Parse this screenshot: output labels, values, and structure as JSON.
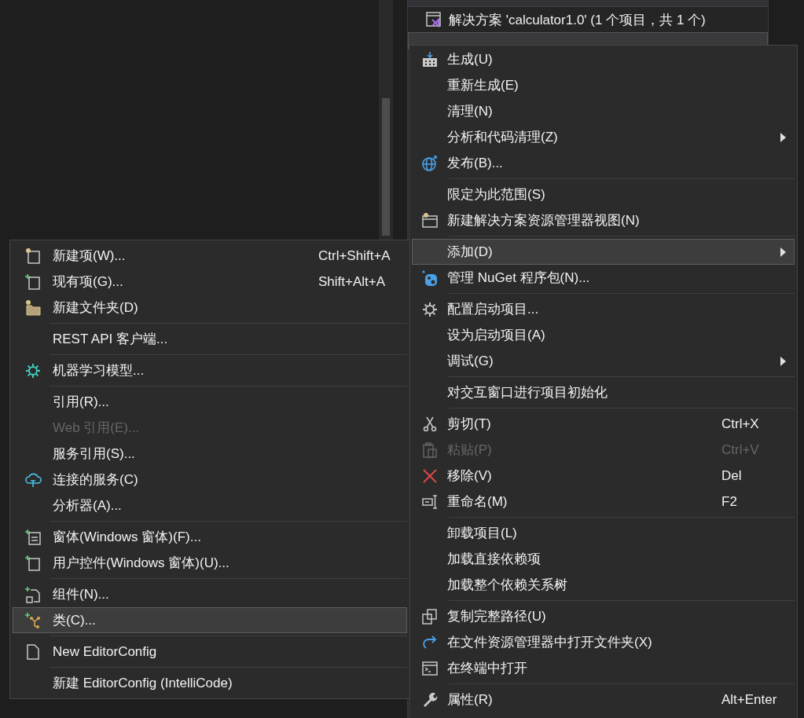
{
  "solution_explorer": {
    "solution_row": {
      "label": "解决方案 'calculator1.0' (1 个项目，共 1 个)"
    }
  },
  "project_menu": {
    "items": [
      {
        "kind": "item",
        "label": "生成(U)",
        "selected": false,
        "disabled": false,
        "submenu": false
      },
      {
        "kind": "item",
        "label": "重新生成(E)",
        "selected": false,
        "disabled": false,
        "submenu": false
      },
      {
        "kind": "item",
        "label": "清理(N)",
        "selected": false,
        "disabled": false,
        "submenu": false
      },
      {
        "kind": "item",
        "label": "分析和代码清理(Z)",
        "selected": false,
        "disabled": false,
        "submenu": true
      },
      {
        "kind": "item",
        "label": "发布(B)...",
        "selected": false,
        "disabled": false,
        "submenu": false
      },
      {
        "kind": "separator"
      },
      {
        "kind": "item",
        "label": "限定为此范围(S)",
        "selected": false,
        "disabled": false,
        "submenu": false
      },
      {
        "kind": "item",
        "label": "新建解决方案资源管理器视图(N)",
        "selected": false,
        "disabled": false,
        "submenu": false
      },
      {
        "kind": "separator"
      },
      {
        "kind": "item",
        "label": "添加(D)",
        "selected": true,
        "disabled": false,
        "submenu": true
      },
      {
        "kind": "item",
        "label": "管理 NuGet 程序包(N)...",
        "selected": false,
        "disabled": false,
        "submenu": false
      },
      {
        "kind": "separator"
      },
      {
        "kind": "item",
        "label": "配置启动项目...",
        "selected": false,
        "disabled": false,
        "submenu": false
      },
      {
        "kind": "item",
        "label": "设为启动项目(A)",
        "selected": false,
        "disabled": false,
        "submenu": false
      },
      {
        "kind": "item",
        "label": "调试(G)",
        "selected": false,
        "disabled": false,
        "submenu": true
      },
      {
        "kind": "separator"
      },
      {
        "kind": "item",
        "label": "对交互窗口进行项目初始化",
        "selected": false,
        "disabled": false,
        "submenu": false
      },
      {
        "kind": "separator"
      },
      {
        "kind": "item",
        "label": "剪切(T)",
        "shortcut": "Ctrl+X",
        "selected": false,
        "disabled": false,
        "submenu": false
      },
      {
        "kind": "item",
        "label": "粘贴(P)",
        "shortcut": "Ctrl+V",
        "selected": false,
        "disabled": true,
        "submenu": false
      },
      {
        "kind": "item",
        "label": "移除(V)",
        "shortcut": "Del",
        "selected": false,
        "disabled": false,
        "submenu": false
      },
      {
        "kind": "item",
        "label": "重命名(M)",
        "shortcut": "F2",
        "selected": false,
        "disabled": false,
        "submenu": false
      },
      {
        "kind": "separator"
      },
      {
        "kind": "item",
        "label": "卸载项目(L)",
        "selected": false,
        "disabled": false,
        "submenu": false
      },
      {
        "kind": "item",
        "label": "加载直接依赖项",
        "selected": false,
        "disabled": false,
        "submenu": false
      },
      {
        "kind": "item",
        "label": "加载整个依赖关系树",
        "selected": false,
        "disabled": false,
        "submenu": false
      },
      {
        "kind": "separator"
      },
      {
        "kind": "item",
        "label": "复制完整路径(U)",
        "selected": false,
        "disabled": false,
        "submenu": false
      },
      {
        "kind": "item",
        "label": "在文件资源管理器中打开文件夹(X)",
        "selected": false,
        "disabled": false,
        "submenu": false
      },
      {
        "kind": "item",
        "label": "在终端中打开",
        "selected": false,
        "disabled": false,
        "submenu": false
      },
      {
        "kind": "separator"
      },
      {
        "kind": "item",
        "label": "属性(R)",
        "shortcut": "Alt+Enter",
        "selected": false,
        "disabled": false,
        "submenu": false
      }
    ]
  },
  "add_submenu": {
    "items": [
      {
        "kind": "item",
        "label": "新建项(W)...",
        "shortcut": "Ctrl+Shift+A",
        "selected": false,
        "disabled": false
      },
      {
        "kind": "item",
        "label": "现有项(G)...",
        "shortcut": "Shift+Alt+A",
        "selected": false,
        "disabled": false
      },
      {
        "kind": "item",
        "label": "新建文件夹(D)",
        "selected": false,
        "disabled": false
      },
      {
        "kind": "separator"
      },
      {
        "kind": "item",
        "label": "REST API 客户端...",
        "selected": false,
        "disabled": false
      },
      {
        "kind": "separator"
      },
      {
        "kind": "item",
        "label": "机器学习模型...",
        "selected": false,
        "disabled": false
      },
      {
        "kind": "separator"
      },
      {
        "kind": "item",
        "label": "引用(R)...",
        "selected": false,
        "disabled": false
      },
      {
        "kind": "item",
        "label": "Web 引用(E)...",
        "selected": false,
        "disabled": true
      },
      {
        "kind": "item",
        "label": "服务引用(S)...",
        "selected": false,
        "disabled": false
      },
      {
        "kind": "item",
        "label": "连接的服务(C)",
        "selected": false,
        "disabled": false
      },
      {
        "kind": "item",
        "label": "分析器(A)...",
        "selected": false,
        "disabled": false
      },
      {
        "kind": "separator"
      },
      {
        "kind": "item",
        "label": "窗体(Windows 窗体)(F)...",
        "selected": false,
        "disabled": false
      },
      {
        "kind": "item",
        "label": "用户控件(Windows 窗体)(U)...",
        "selected": false,
        "disabled": false
      },
      {
        "kind": "separator"
      },
      {
        "kind": "item",
        "label": "组件(N)...",
        "selected": false,
        "disabled": false
      },
      {
        "kind": "item",
        "label": "类(C)...",
        "selected": true,
        "disabled": false
      },
      {
        "kind": "separator"
      },
      {
        "kind": "item",
        "label": "New EditorConfig",
        "selected": false,
        "disabled": false
      },
      {
        "kind": "separator"
      },
      {
        "kind": "item",
        "label": "新建 EditorConfig (IntelliCode)",
        "selected": false,
        "disabled": false
      }
    ]
  }
}
